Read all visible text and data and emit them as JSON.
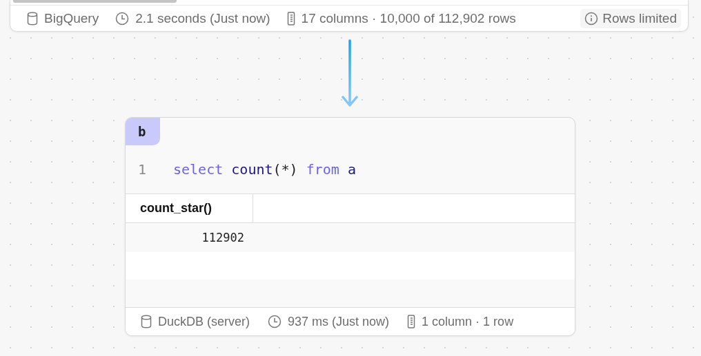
{
  "top_result": {
    "status_bar": [
      {
        "kind": "database",
        "text": "BigQuery"
      },
      {
        "kind": "clock",
        "text": "2.1 seconds (Just now)"
      },
      {
        "kind": "ruler",
        "text": "17 columns · 10,000 of 112,902 rows"
      }
    ],
    "notice": {
      "text": "Rows limited"
    }
  },
  "cell": {
    "name": "b",
    "code_lines": [
      {
        "number": "1",
        "tokens": [
          {
            "kind": "keyword",
            "text": "select "
          },
          {
            "kind": "function",
            "text": "count"
          },
          {
            "kind": "punct",
            "text": "(*) "
          },
          {
            "kind": "keyword",
            "text": "from "
          },
          {
            "kind": "ident",
            "text": "a"
          }
        ]
      }
    ],
    "table": {
      "columns": [
        "count_star()"
      ],
      "rows": [
        [
          "112902"
        ]
      ]
    },
    "status_bar": [
      {
        "kind": "database",
        "text": "DuckDB (server)"
      },
      {
        "kind": "clock",
        "text": "937 ms (Just now)"
      },
      {
        "kind": "ruler",
        "text": "1 column · 1 row"
      }
    ]
  }
}
